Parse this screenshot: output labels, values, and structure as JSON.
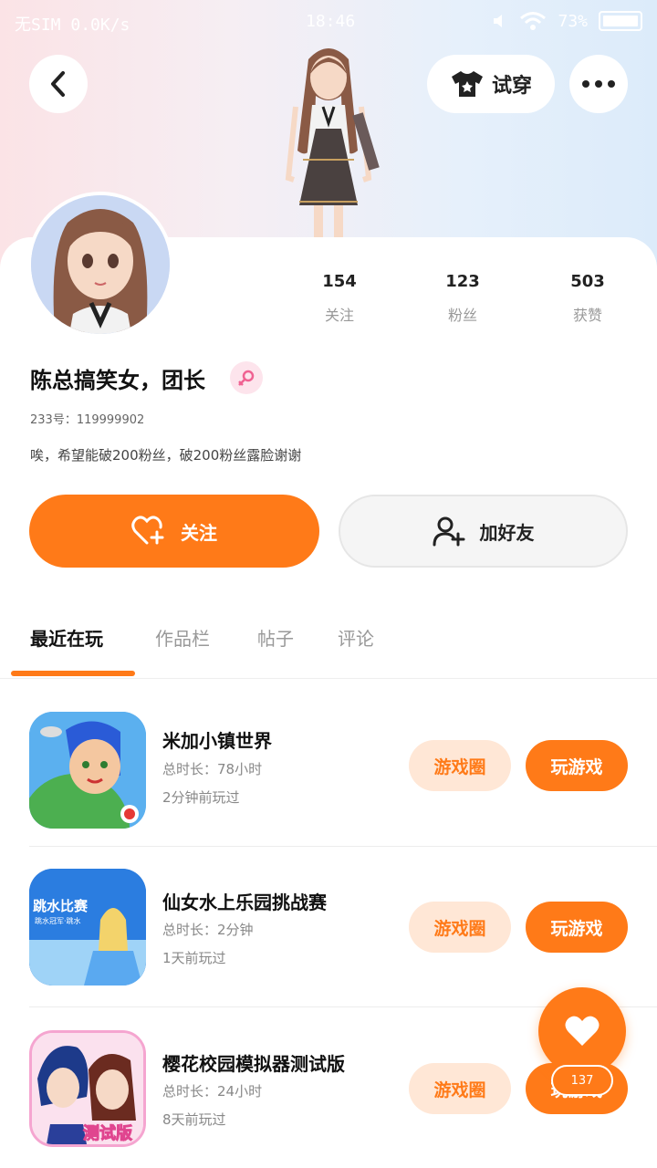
{
  "status_bar": {
    "carrier": "无SIM",
    "speed": "0.0K/s",
    "time": "18:46",
    "battery": "73%"
  },
  "header": {
    "try_on_label": "试穿"
  },
  "profile": {
    "stats": [
      {
        "value": "154",
        "label": "关注"
      },
      {
        "value": "123",
        "label": "粉丝"
      },
      {
        "value": "503",
        "label": "获赞"
      }
    ],
    "username": "陈总搞笑女，团长",
    "uid": "233号：119999902",
    "bio": "唉，希望能破200粉丝，破200粉丝露脸谢谢"
  },
  "actions": {
    "follow_label": "关注",
    "add_friend_label": "加好友"
  },
  "tabs": [
    {
      "label": "最近在玩"
    },
    {
      "label": "作品栏"
    },
    {
      "label": "帖子"
    },
    {
      "label": "评论"
    }
  ],
  "games": [
    {
      "title": "米加小镇世界",
      "duration": "总时长：78小时",
      "last_played": "2分钟前玩过",
      "circle_label": "游戏圈",
      "play_label": "玩游戏"
    },
    {
      "title": "仙女水上乐园挑战赛",
      "duration": "总时长：2分钟",
      "last_played": "1天前玩过",
      "circle_label": "游戏圈",
      "play_label": "玩游戏",
      "icon_text_top": "跳水比赛",
      "icon_text_sub": "跳水冠军·跳水"
    },
    {
      "title": "樱花校园模拟器测试版",
      "duration": "总时长：24小时",
      "last_played": "8天前玩过",
      "circle_label": "游戏圈",
      "play_label": "玩游戏",
      "icon_text_top": "测试版"
    }
  ],
  "like_fab": {
    "count": "137"
  },
  "colors": {
    "accent": "#ff7a18",
    "accent_soft": "#ffe7d6"
  }
}
